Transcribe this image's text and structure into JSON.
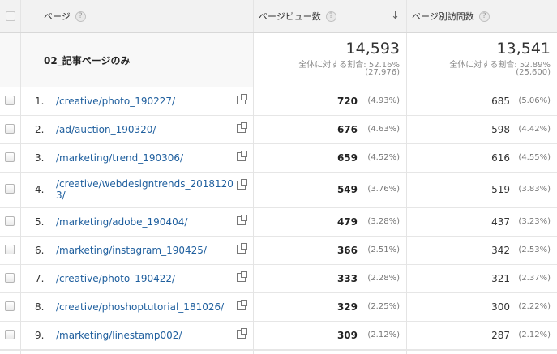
{
  "header": {
    "page_col": "ページ",
    "pageviews_col": "ページビュー数",
    "unique_col": "ページ別訪問数",
    "help": "?",
    "sort_arrow": "↓"
  },
  "summary": {
    "label": "02_記事ページのみ",
    "pageviews": {
      "value": "14,593",
      "ratio": "全体に対する割合: 52.16%",
      "total": "(27,976)"
    },
    "unique": {
      "value": "13,541",
      "ratio": "全体に対する割合: 52.89%",
      "total": "(25,600)"
    }
  },
  "rows": [
    {
      "index": "1.",
      "page": "/creative/photo_190227/",
      "pv": "720",
      "pv_pct": "(4.93%)",
      "uv": "685",
      "uv_pct": "(5.06%)"
    },
    {
      "index": "2.",
      "page": "/ad/auction_190320/",
      "pv": "676",
      "pv_pct": "(4.63%)",
      "uv": "598",
      "uv_pct": "(4.42%)"
    },
    {
      "index": "3.",
      "page": "/marketing/trend_190306/",
      "pv": "659",
      "pv_pct": "(4.52%)",
      "uv": "616",
      "uv_pct": "(4.55%)"
    },
    {
      "index": "4.",
      "page": "/creative/webdesigntrends_20181203/",
      "pv": "549",
      "pv_pct": "(3.76%)",
      "uv": "519",
      "uv_pct": "(3.83%)"
    },
    {
      "index": "5.",
      "page": "/marketing/adobe_190404/",
      "pv": "479",
      "pv_pct": "(3.28%)",
      "uv": "437",
      "uv_pct": "(3.23%)"
    },
    {
      "index": "6.",
      "page": "/marketing/instagram_190425/",
      "pv": "366",
      "pv_pct": "(2.51%)",
      "uv": "342",
      "uv_pct": "(2.53%)"
    },
    {
      "index": "7.",
      "page": "/creative/photo_190422/",
      "pv": "333",
      "pv_pct": "(2.28%)",
      "uv": "321",
      "uv_pct": "(2.37%)"
    },
    {
      "index": "8.",
      "page": "/creative/phoshoptutorial_181026/",
      "pv": "329",
      "pv_pct": "(2.25%)",
      "uv": "300",
      "uv_pct": "(2.22%)"
    },
    {
      "index": "9.",
      "page": "/marketing/linestamp002/",
      "pv": "309",
      "pv_pct": "(2.12%)",
      "uv": "287",
      "uv_pct": "(2.12%)"
    }
  ]
}
